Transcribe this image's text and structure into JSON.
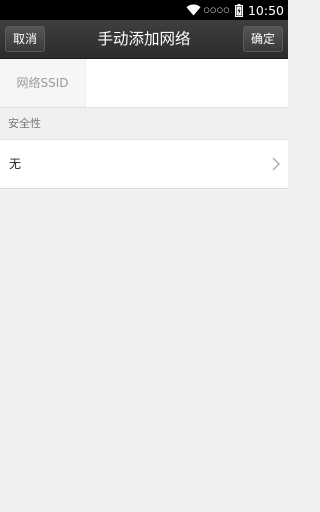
{
  "status_bar": {
    "time": "10:50",
    "signal": "○○○○"
  },
  "header": {
    "title": "手动添加网络",
    "cancel_label": "取消",
    "confirm_label": "确定"
  },
  "form": {
    "ssid_label": "网络SSID",
    "ssid_value": "",
    "security_section_label": "安全性",
    "security_value": "无"
  },
  "icons": {
    "wifi": "wifi-icon",
    "battery": "battery-icon",
    "chevron": "chevron-right-icon"
  },
  "colors": {
    "title_bar": "#333333",
    "background": "#f0f0f0",
    "row_background": "#ffffff"
  }
}
